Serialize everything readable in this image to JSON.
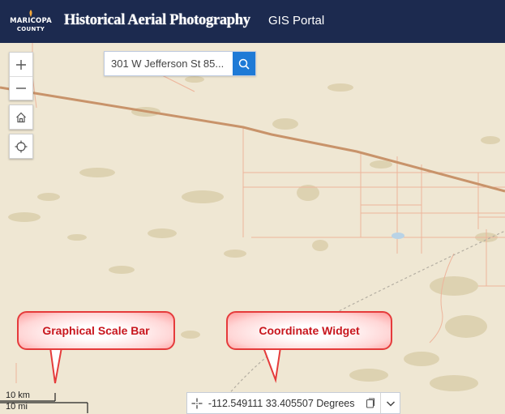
{
  "header": {
    "logo_line1": "MARICOPA",
    "logo_line2": "COUNTY",
    "title": "Historical Aerial Photography",
    "portal_link": "GIS Portal"
  },
  "search": {
    "value": "301 W Jefferson St 85..."
  },
  "map_controls": {
    "zoom_in_icon": "plus-icon",
    "zoom_out_icon": "minus-icon",
    "home_icon": "home-icon",
    "locate_icon": "crosshair-icon"
  },
  "callouts": {
    "scale": "Graphical Scale Bar",
    "coordinate": "Coordinate Widget"
  },
  "scalebar": {
    "km": "10 km",
    "mi": "10 mi"
  },
  "coordinate_widget": {
    "text": "-112.549111 33.405507 Degrees"
  },
  "colors": {
    "header_bg": "#1c2a4f",
    "map_bg": "#efe7d3",
    "search_button": "#1e7ad6",
    "callout_border": "#e53b3b",
    "callout_text": "#c8161d"
  }
}
